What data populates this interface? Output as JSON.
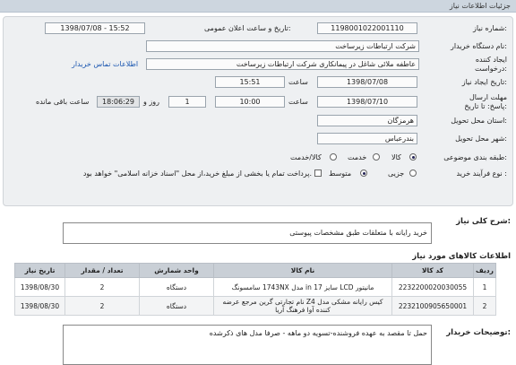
{
  "header": {
    "title": "جزئیات اطلاعات نیاز"
  },
  "form": {
    "need_number_label": "شماره نیاز:",
    "need_number": "1198001022001110",
    "announce_label": "تاریخ و ساعت اعلان عمومی:",
    "announce_value": "1398/07/08 - 15:52",
    "buyer_label": "نام دستگاه خریدار:",
    "buyer_value": "شرکت ارتباطات زیرساخت",
    "creator_label": "ایجاد کننده درخواست:",
    "creator_value": "عاطفه ملائی شاغل در پیمانکاری شرکت ارتباطات زیرساخت",
    "contact_link": "اطلاعات تماس خریدار",
    "created_label": "تاریخ ایجاد نیاز:",
    "created_date": "1398/07/08",
    "time_label": "ساعت",
    "created_time": "15:51",
    "deadline_label": "مهلت ارسال پاسخ: تا تاریخ:",
    "deadline_date": "1398/07/10",
    "deadline_time": "10:00",
    "days_value": "1",
    "days_label": "روز و",
    "remaining_time": "18:06:29",
    "remaining_label": "ساعت باقی مانده",
    "province_label": "استان محل تحویل:",
    "province_value": "هرمزگان",
    "city_label": "شهر محل تحویل:",
    "city_value": "بندرعباس",
    "category_label": "طبقه بندی موضوعی:",
    "category_options": [
      "کالا",
      "خدمت",
      "کالا/خدمت"
    ],
    "purchase_label": "نوع فرآیند خرید :",
    "purchase_options": [
      "جزیی",
      "متوسط"
    ],
    "payment_note": "پرداخت تمام یا بخشی از مبلغ خرید،از محل \"اسناد خزانه اسلامی\" خواهد بود."
  },
  "summary": {
    "label": "شرح کلی نیاز:",
    "value": "خرید رایانه با متعلقات طبق مشخصات پیوستی"
  },
  "items_section": {
    "title": "اطلاعات کالاهای مورد نیاز"
  },
  "table": {
    "headers": [
      "ردیف",
      "کد کالا",
      "نام کالا",
      "واحد شمارش",
      "تعداد / مقدار",
      "تاریخ نیاز"
    ],
    "rows": [
      [
        "1",
        "2232200020030055",
        "مانیتور LCD سایز 17 in مدل 1743NX سامسونگ",
        "دستگاه",
        "2",
        "1398/08/30"
      ],
      [
        "2",
        "2232100905650001",
        "کیس رایانه مشکی مدل Z4 نام تجارتی گرین مرجع عرضه کننده آوا فرهنگ آریا",
        "دستگاه",
        "2",
        "1398/08/30"
      ]
    ]
  },
  "notes": {
    "label": "توضیحات خریدار:",
    "value": "حمل تا مقصد به عهده فروشنده-تسویه دو ماهه -  صرفا مدل های ذکرشده"
  }
}
